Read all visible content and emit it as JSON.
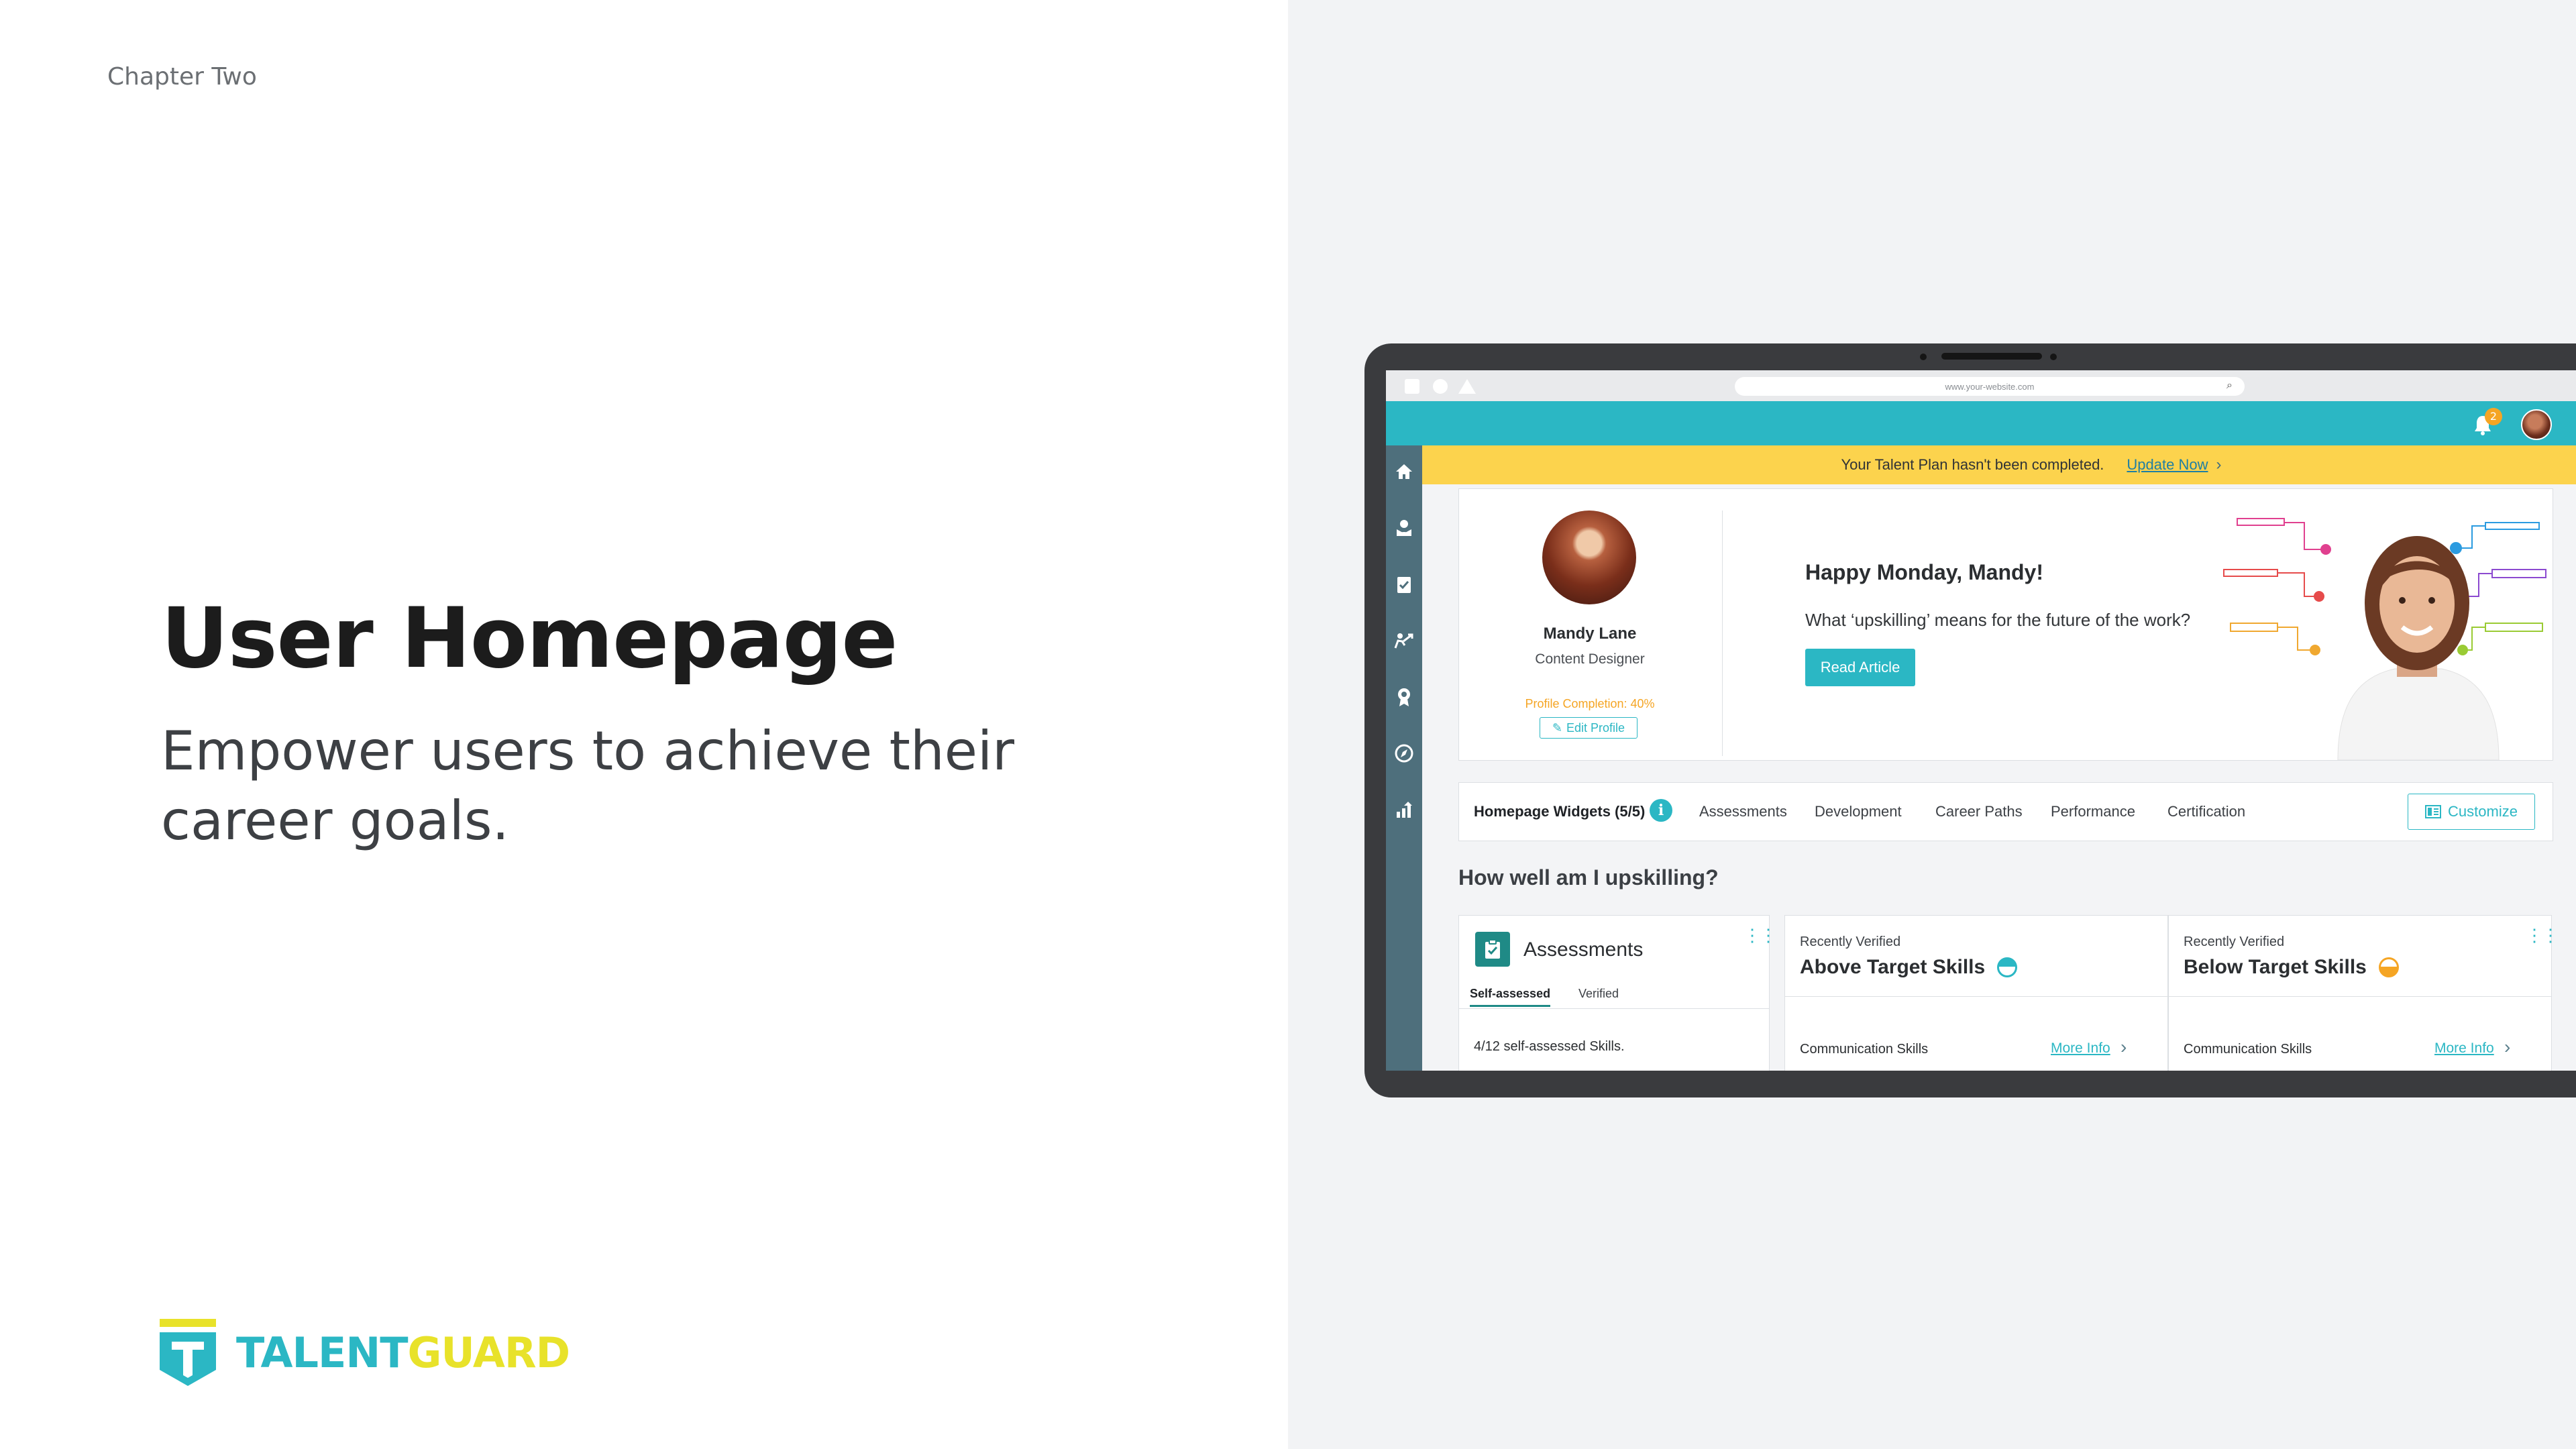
{
  "slide": {
    "chapter": "Chapter Two",
    "title": "User Homepage",
    "subtitle": "Empower users to achieve their career goals."
  },
  "logo": {
    "text_a": "TALENT",
    "text_b": "GUARD",
    "colors": {
      "teal": "#2bb7c4",
      "yellow": "#e8e22a"
    }
  },
  "browser": {
    "url": "www.your-website.com"
  },
  "app": {
    "notifications_count": "2",
    "banner": {
      "message": "Your Talent Plan hasn't been completed.",
      "link": "Update Now"
    },
    "sidebar": [
      "home-icon",
      "profile-icon",
      "assessment-icon",
      "development-icon",
      "certification-icon",
      "career-paths-icon",
      "performance-icon"
    ],
    "profile": {
      "name": "Mandy Lane",
      "role": "Content Designer",
      "completion": "Profile Completion: 40%",
      "edit": "Edit Profile"
    },
    "greeting": "Happy Monday, Mandy!",
    "article_question": "What ‘upskilling’ means for the future of the work?",
    "read_article": "Read Article",
    "tabs": {
      "widgets": "Homepage Widgets (5/5)",
      "info": "i",
      "items": [
        "Assessments",
        "Development",
        "Career Paths",
        "Performance",
        "Certification"
      ],
      "customize": "Customize"
    },
    "section_title": "How well am I upskilling?",
    "assessments": {
      "title": "Assessments",
      "subtabs": [
        "Self-assessed",
        "Verified"
      ],
      "stat": "4/12 self-assessed Skills."
    },
    "skills_above": {
      "eyebrow": "Recently Verified",
      "title": "Above Target Skills",
      "row_label": "Communication Skills",
      "more": "More Info"
    },
    "skills_below": {
      "eyebrow": "Recently Verified",
      "title": "Below Target Skills",
      "row_label": "Communication Skills",
      "more": "More Info"
    },
    "colors": {
      "teal": "#2bb7c4",
      "banner": "#fcd34d",
      "sidebar": "#4e6f7c",
      "warning": "#f5a524"
    }
  }
}
